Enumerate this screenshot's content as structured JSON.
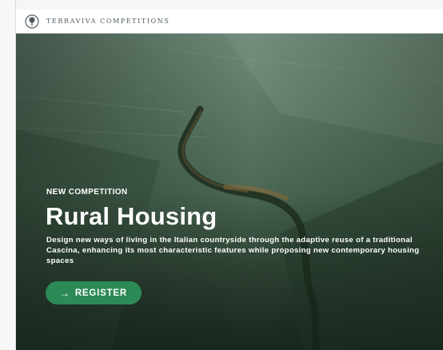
{
  "header": {
    "brand": "Terraviva Competitions",
    "logo_icon": "tree-logo-icon"
  },
  "hero": {
    "eyebrow": "NEW COMPETITION",
    "title": "Rural Housing",
    "description": "Design new ways of living in the Italian countryside through the adaptive reuse of a traditional Cascina, enhancing its most characteristic features while proposing new contemporary housing spaces",
    "register": {
      "icon": "→",
      "label": "REGISTER"
    }
  },
  "colors": {
    "accent": "#2c8a57",
    "hero_overlay": "#3d5b46",
    "topbar_bg": "#ffffff"
  }
}
